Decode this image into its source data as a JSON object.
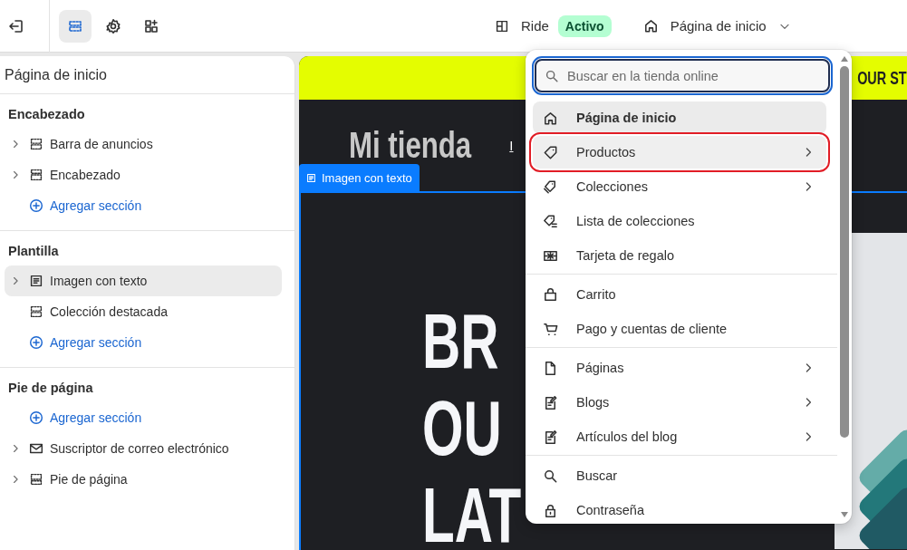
{
  "toolbar": {
    "tools": [
      {
        "kind": "sections",
        "selected": true
      },
      {
        "kind": "settings",
        "selected": false
      },
      {
        "kind": "apps",
        "selected": false
      }
    ]
  },
  "topbar": {
    "theme_name": "Ride",
    "theme_status": "Activo",
    "page_selector": "Página de inicio"
  },
  "sidebar": {
    "title": "Página de inicio",
    "groups": [
      {
        "title": "Encabezado",
        "items": [
          {
            "kind": "announcement",
            "label": "Barra de anuncios",
            "expandable": true,
            "selected": false
          },
          {
            "kind": "header",
            "label": "Encabezado",
            "expandable": true,
            "selected": false
          },
          {
            "kind": "add",
            "label": "Agregar sección",
            "expandable": false,
            "selected": false
          }
        ]
      },
      {
        "title": "Plantilla",
        "items": [
          {
            "kind": "text-image",
            "label": "Imagen con texto",
            "expandable": true,
            "selected": true
          },
          {
            "kind": "announcement",
            "label": "Colección destacada",
            "expandable": false,
            "selected": false
          },
          {
            "kind": "add",
            "label": "Agregar sección",
            "expandable": false,
            "selected": false
          }
        ]
      },
      {
        "title": "Pie de página",
        "items": [
          {
            "kind": "add",
            "label": "Agregar sección",
            "expandable": false,
            "selected": false
          },
          {
            "kind": "email",
            "label": "Suscriptor de correo electrónico",
            "expandable": true,
            "selected": false
          },
          {
            "kind": "footer",
            "label": "Pie de página",
            "expandable": true,
            "selected": false
          }
        ]
      }
    ]
  },
  "preview": {
    "announcement": "OUR ST",
    "store_name": "Mi tienda",
    "nav_link": "I",
    "section_tag": "Imagen con texto",
    "headline_lines": [
      "BR",
      "OU",
      "LAT"
    ]
  },
  "menu": {
    "search": {
      "placeholder": "Buscar en la tienda online"
    },
    "groups": [
      [
        {
          "kind": "home",
          "label": "Página de inicio",
          "submenu": false,
          "selected": true,
          "highlighted": false
        },
        {
          "kind": "tag",
          "label": "Productos",
          "submenu": true,
          "selected": false,
          "highlighted": true
        },
        {
          "kind": "tags",
          "label": "Colecciones",
          "submenu": true,
          "selected": false,
          "highlighted": false
        },
        {
          "kind": "tag-list",
          "label": "Lista de colecciones",
          "submenu": false,
          "selected": false,
          "highlighted": false
        },
        {
          "kind": "gift",
          "label": "Tarjeta de regalo",
          "submenu": false,
          "selected": false,
          "highlighted": false
        }
      ],
      [
        {
          "kind": "bag",
          "label": "Carrito",
          "submenu": false,
          "selected": false,
          "highlighted": false
        },
        {
          "kind": "cart",
          "label": "Pago y cuentas de cliente",
          "submenu": false,
          "selected": false,
          "highlighted": false
        }
      ],
      [
        {
          "kind": "page",
          "label": "Páginas",
          "submenu": true,
          "selected": false,
          "highlighted": false
        },
        {
          "kind": "blog",
          "label": "Blogs",
          "submenu": true,
          "selected": false,
          "highlighted": false
        },
        {
          "kind": "blog",
          "label": "Artículos del blog",
          "submenu": true,
          "selected": false,
          "highlighted": false
        }
      ],
      [
        {
          "kind": "search",
          "label": "Buscar",
          "submenu": false,
          "selected": false,
          "highlighted": false
        },
        {
          "kind": "lock",
          "label": "Contraseña",
          "submenu": false,
          "selected": false,
          "highlighted": false
        }
      ]
    ]
  }
}
